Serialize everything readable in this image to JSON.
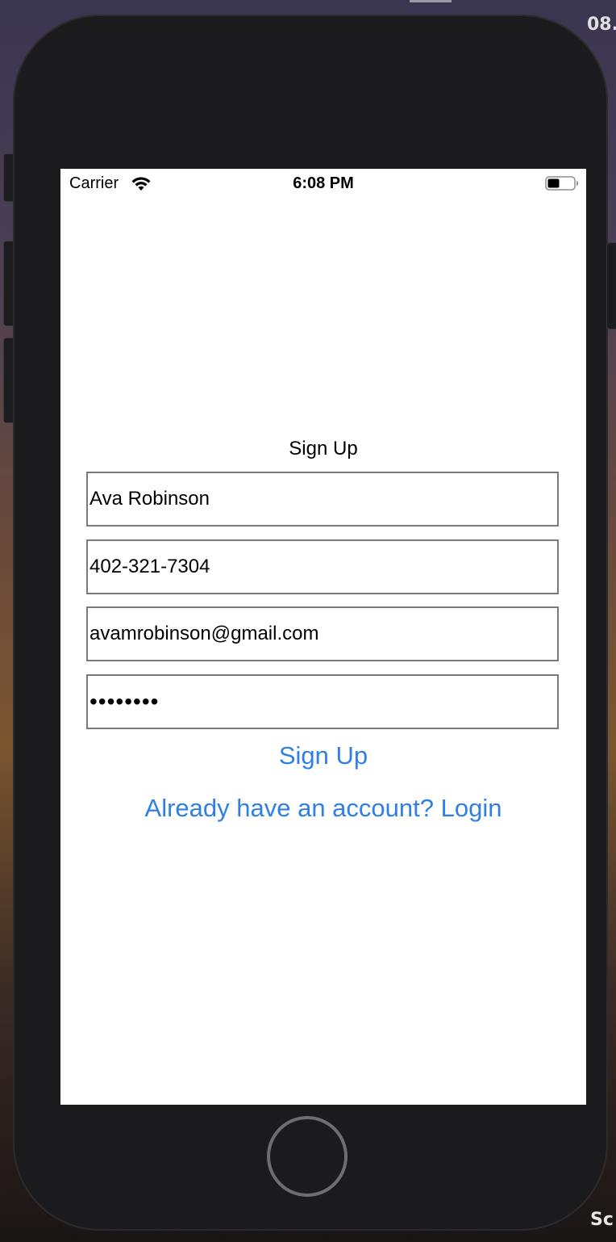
{
  "desktop": {
    "top_right_text": "08.",
    "bottom_right_text": "Sc"
  },
  "status_bar": {
    "carrier": "Carrier",
    "time": "6:08 PM",
    "wifi_icon": "wifi-icon",
    "battery_icon": "battery-icon"
  },
  "form": {
    "title": "Sign Up",
    "name_value": "Ava Robinson",
    "phone_value": "402-321-7304",
    "email_value": "avamrobinson@gmail.com",
    "password_value": "abcdefgh",
    "signup_label": "Sign Up",
    "login_label": "Already have an account? Login"
  },
  "colors": {
    "accent": "#2f7fe6",
    "field_border": "#7a7a7a",
    "device_body": "#1b1b1d"
  }
}
